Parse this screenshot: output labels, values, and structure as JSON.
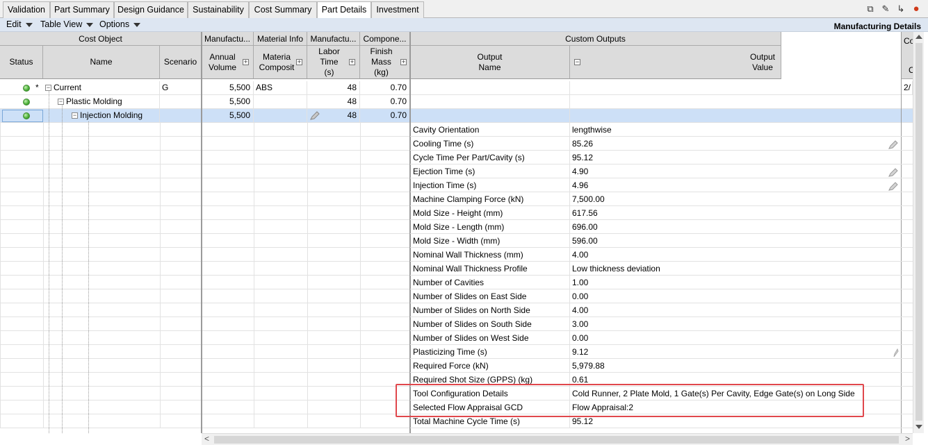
{
  "tabs": [
    {
      "label": "Validation",
      "active": false
    },
    {
      "label": "Part Summary",
      "active": false
    },
    {
      "label": "Design Guidance",
      "active": false
    },
    {
      "label": "Sustainability",
      "active": false
    },
    {
      "label": "Cost Summary",
      "active": false
    },
    {
      "label": "Part Details",
      "active": true
    },
    {
      "label": "Investment",
      "active": false
    }
  ],
  "menu": {
    "edit": "Edit",
    "table_view": "Table View",
    "options": "Options"
  },
  "panel_title": "Manufacturing Details",
  "groups": {
    "cost_object": "Cost Object",
    "manufacturing_1": "Manufactu...",
    "material_info": "Material Info",
    "manufacturing_2": "Manufactu...",
    "component": "Compone...",
    "custom_outputs": "Custom Outputs",
    "right_fragment": "Co"
  },
  "columns": {
    "status": "Status",
    "name": "Name",
    "scenario": "Scenario",
    "annual_volume": "Annual Volume",
    "material_composition": "Materia Composit",
    "labor_time": "Labor Time (s)",
    "finish_mass": "Finish Mass (kg)",
    "output_name": "Output Name",
    "output_value": "Output Value",
    "right_fragment": "C"
  },
  "rows": [
    {
      "marker": "*",
      "name": "Current",
      "scenario": "G",
      "annual_volume": "5,500",
      "material": "ABS",
      "labor_time": "48",
      "finish_mass": "0.70",
      "extra": "2/"
    },
    {
      "marker": "",
      "name": "Plastic Molding",
      "scenario": "",
      "annual_volume": "5,500",
      "material": "",
      "labor_time": "48",
      "finish_mass": "0.70",
      "extra": ""
    },
    {
      "marker": "",
      "name": "Injection Molding",
      "scenario": "",
      "annual_volume": "5,500",
      "material": "",
      "labor_time": "48",
      "finish_mass": "0.70",
      "extra": ""
    }
  ],
  "outputs": [
    {
      "name": "Cavity Orientation",
      "value": "lengthwise"
    },
    {
      "name": "Cooling Time (s)",
      "value": "85.26"
    },
    {
      "name": "Cycle Time Per Part/Cavity (s)",
      "value": "95.12"
    },
    {
      "name": "Ejection Time (s)",
      "value": "4.90"
    },
    {
      "name": "Injection Time (s)",
      "value": "4.96"
    },
    {
      "name": "Machine Clamping Force (kN)",
      "value": "7,500.00"
    },
    {
      "name": "Mold Size - Height (mm)",
      "value": "617.56"
    },
    {
      "name": "Mold Size - Length  (mm)",
      "value": "696.00"
    },
    {
      "name": "Mold Size - Width  (mm)",
      "value": "596.00"
    },
    {
      "name": "Nominal Wall Thickness (mm)",
      "value": "4.00"
    },
    {
      "name": "Nominal Wall Thickness Profile",
      "value": "Low thickness deviation"
    },
    {
      "name": "Number of Cavities",
      "value": "1.00"
    },
    {
      "name": "Number of Slides on East Side",
      "value": "0.00"
    },
    {
      "name": "Number of Slides on North Side",
      "value": "4.00"
    },
    {
      "name": "Number of Slides on South Side",
      "value": "3.00"
    },
    {
      "name": "Number of Slides on West Side",
      "value": "0.00"
    },
    {
      "name": "Plasticizing Time (s)",
      "value": "9.12"
    },
    {
      "name": "Required Force (kN)",
      "value": "5,979.88"
    },
    {
      "name": "Required Shot Size (GPPS) (kg)",
      "value": "0.61"
    },
    {
      "name": "Tool Configuration Details",
      "value": "Cold Runner, 2 Plate Mold, 1 Gate(s) Per Cavity, Edge Gate(s) on Long Side"
    },
    {
      "name": "Selected Flow Appraisal GCD",
      "value": "Flow Appraisal:2"
    },
    {
      "name": "Total Machine Cycle Time (s)",
      "value": "95.12"
    }
  ],
  "icons": {
    "toolbar": [
      "window-icon",
      "paperclip-icon",
      "branch-icon",
      "alert-icon"
    ],
    "accent": "#e0474c",
    "status_green": "#4fb33c"
  }
}
